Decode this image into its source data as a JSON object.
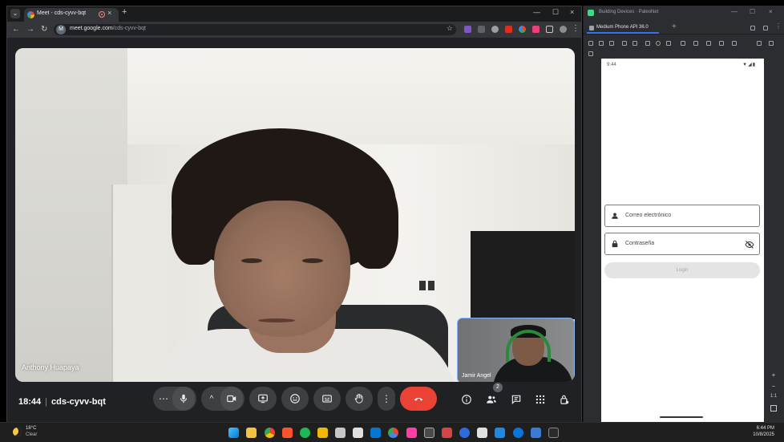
{
  "chrome": {
    "tab_title": "Meet - cds-cyvv-bqt",
    "url_domain": "meet.google.com",
    "url_path": "/cds-cyvv-bqt",
    "site_icon_letter": "M"
  },
  "meet": {
    "main_participant": "Anthony Huapaya",
    "self_participant": "Jamir Angel",
    "time": "18:44",
    "meeting_code": "cds-cyvv-bqt",
    "people_count": "2",
    "end_call_color": "#ea4335",
    "accent_color": "#8ab4f8"
  },
  "studio": {
    "window_title": "Building Devices · PaleoNet",
    "device_tab": "Medium Phone API 36.0",
    "phone": {
      "status_time": "9:44",
      "status_icons": "▼◢▮",
      "email_label": "Correo electrónico",
      "password_label": "Contraseña",
      "login_label": "Login"
    },
    "rail": {
      "plus": "+",
      "minus": "−",
      "ratio": "1:1"
    }
  },
  "taskbar": {
    "weather_temp": "18°C",
    "weather_desc": "Clear",
    "time": "6:44 PM",
    "date": "10/8/2025"
  },
  "glyphs": {
    "chevron_down": "⌄",
    "close": "×",
    "plus": "+",
    "minimize": "—",
    "maximize": "☐",
    "back": "←",
    "forward": "→",
    "reload": "↻",
    "star": "☆",
    "menu": "⋮",
    "more_h": "⋯",
    "caret_up": "^"
  }
}
